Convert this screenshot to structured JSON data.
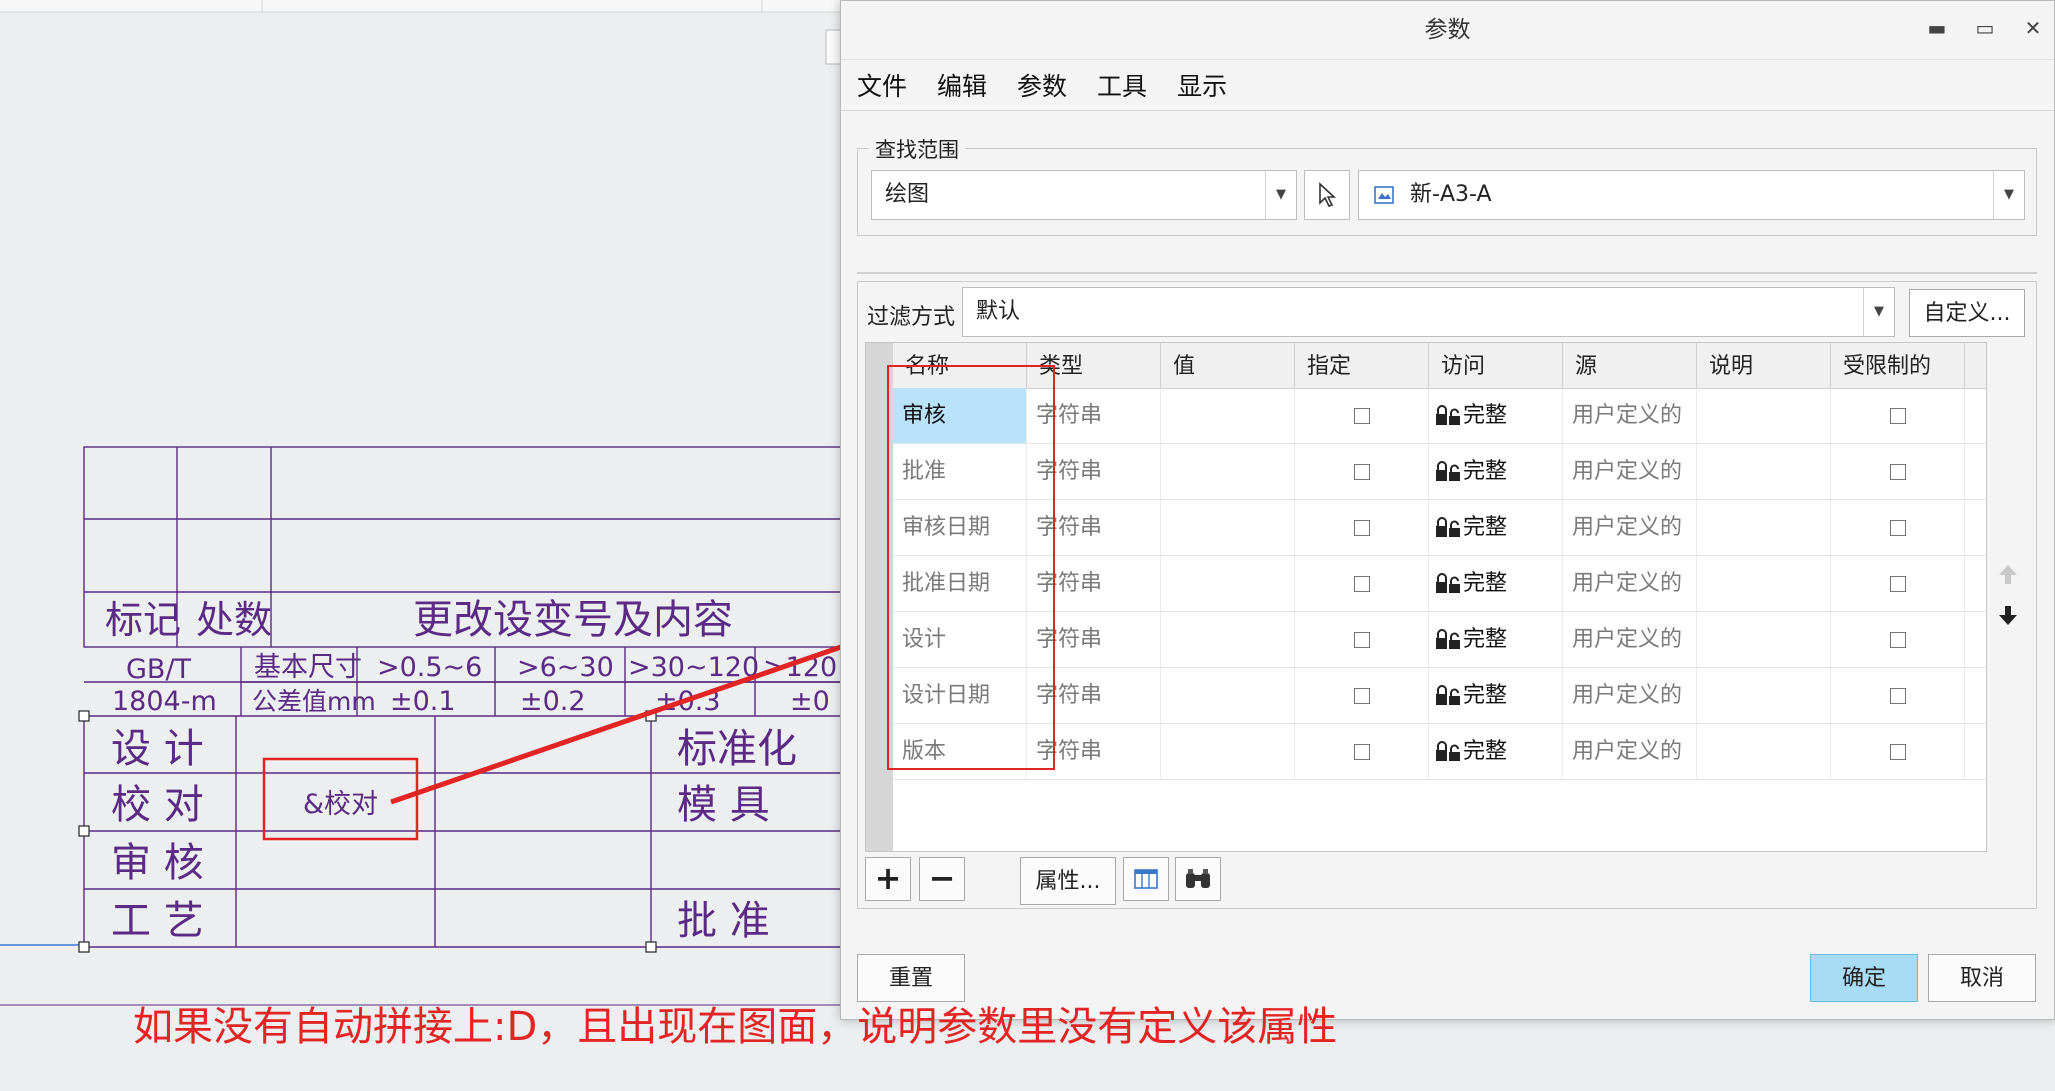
{
  "dialog": {
    "title": "参数",
    "menus": [
      "文件",
      "编辑",
      "参数",
      "工具",
      "显示"
    ],
    "scope": {
      "group_label": "查找范围",
      "scope_value": "绘图",
      "object_value": "新-A3-A"
    },
    "filter": {
      "label": "过滤方式",
      "value": "默认",
      "customize_label": "自定义..."
    },
    "table": {
      "columns": [
        "名称",
        "类型",
        "值",
        "指定",
        "访问",
        "源",
        "说明",
        "受限制的"
      ],
      "rows": [
        {
          "name": "审核",
          "type": "字符串",
          "value": "",
          "access": "完整",
          "source": "用户定义的",
          "note": "",
          "selected": true
        },
        {
          "name": "批准",
          "type": "字符串",
          "value": "",
          "access": "完整",
          "source": "用户定义的",
          "note": "",
          "selected": false
        },
        {
          "name": "审核日期",
          "type": "字符串",
          "value": "",
          "access": "完整",
          "source": "用户定义的",
          "note": "",
          "selected": false
        },
        {
          "name": "批准日期",
          "type": "字符串",
          "value": "",
          "access": "完整",
          "source": "用户定义的",
          "note": "",
          "selected": false
        },
        {
          "name": "设计",
          "type": "字符串",
          "value": "",
          "access": "完整",
          "source": "用户定义的",
          "note": "",
          "selected": false
        },
        {
          "name": "设计日期",
          "type": "字符串",
          "value": "",
          "access": "完整",
          "source": "用户定义的",
          "note": "",
          "selected": false
        },
        {
          "name": "版本",
          "type": "字符串",
          "value": "",
          "access": "完整",
          "source": "用户定义的",
          "note": "",
          "selected": false
        }
      ]
    },
    "toolbar": {
      "add_label": "+",
      "remove_label": "−",
      "properties_label": "属性..."
    },
    "footer": {
      "reset_label": "重置",
      "ok_label": "确定",
      "cancel_label": "取消"
    }
  },
  "drawing": {
    "revision_header": {
      "mark": "标记",
      "count": "处数",
      "content": "更改设变号及内容"
    },
    "tolerance": {
      "standard": "GB/T\n1804-m",
      "base_size_label": "基本尺寸",
      "tolerance_label": "公差值mm",
      "ranges": [
        ">0.5~6",
        ">6~30",
        ">30~120",
        ">120"
      ],
      "values": [
        "±0.1",
        "±0.2",
        "±0.3",
        "±0"
      ]
    },
    "left_labels": [
      "设  计",
      "校  对",
      "审  核",
      "工  艺"
    ],
    "right_labels": [
      "标准化",
      "模  具",
      "批  准"
    ],
    "check_field": "&校对"
  },
  "annotation": {
    "note": "如果没有自动拼接上:D，且出现在图面，说明参数里没有定义该属性",
    "color": "#e22424"
  },
  "colors": {
    "selection": "#b9e3fb",
    "primary_button": "#a8dcf5",
    "cad_line": "#5a2a84"
  }
}
